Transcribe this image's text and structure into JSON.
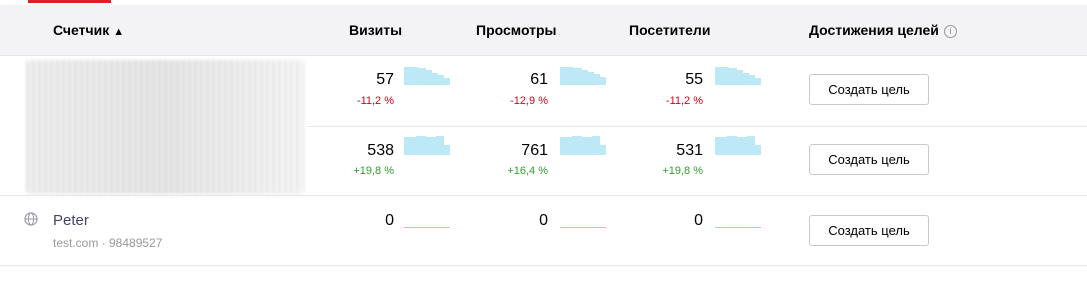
{
  "header": {
    "counter_label": "Счетчик",
    "sort_arrow": "▲",
    "visits_label": "Визиты",
    "views_label": "Просмотры",
    "visitors_label": "Посетители",
    "goals_label": "Достижения целей",
    "info_icon": "i"
  },
  "rows": [
    {
      "visits": "57",
      "visits_delta": "-11,2 %",
      "views": "61",
      "views_delta": "-12,9 %",
      "visitors": "55",
      "visitors_delta": "-11,2 %",
      "button_label": "Создать цель"
    },
    {
      "visits": "538",
      "visits_delta": "+19,8 %",
      "views": "761",
      "views_delta": "+16,4 %",
      "visitors": "531",
      "visitors_delta": "+19,8 %",
      "button_label": "Создать цель"
    },
    {
      "name": "Peter",
      "meta": "test.com · 98489527",
      "visits": "0",
      "views": "0",
      "visitors": "0",
      "button_label": "Создать цель"
    }
  ],
  "colors": {
    "accent": "#e31b23",
    "negative": "#d0021b",
    "positive": "#2e9e2e",
    "sparkline": "#bde8f6"
  }
}
